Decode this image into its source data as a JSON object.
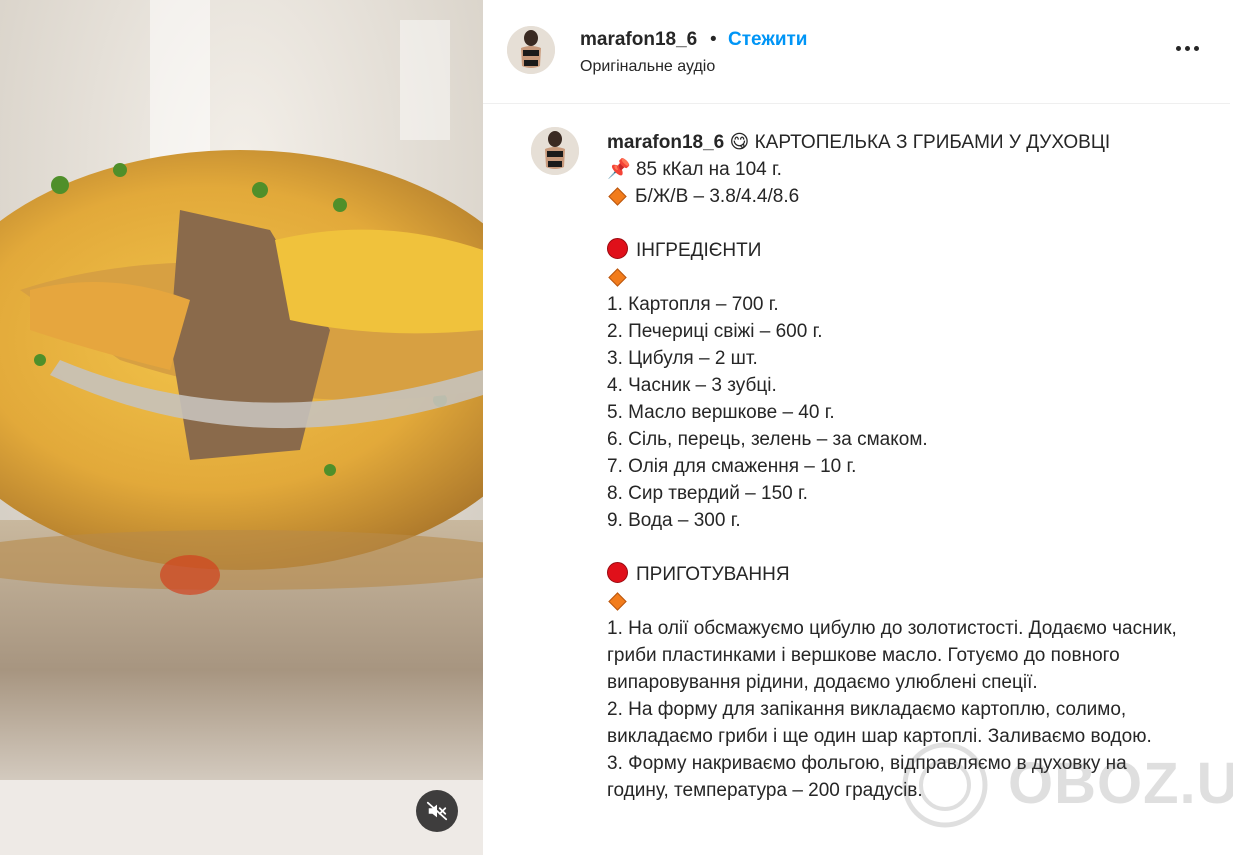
{
  "post": {
    "username": "marafon18_6",
    "separator": "•",
    "follow_label": "Стежити",
    "audio_label": "Оригінальне аудіо"
  },
  "caption": {
    "username": "marafon18_6",
    "title_emoji": "😋",
    "title": "КАРТОПЕЛЬКА З ГРИБАМИ У ДУХОВЦІ",
    "pin_emoji": "📌",
    "kcal": "85 кКал на 104 г.",
    "bju": "Б/Ж/В – 3.8/4.4/8.6",
    "ingredients_heading": "ІНГРЕДІЄНТИ",
    "ingredients": [
      "1. Картопля – 700 г.",
      "2. Печериці свіжі – 600 г.",
      "3. Цибуля – 2 шт.",
      "4. Часник – 3 зубці.",
      "5. Масло вершкове – 40 г.",
      "6. Сіль, перець, зелень – за смаком.",
      "7. Олія для смаження – 10 г.",
      "8. Сир твердий – 150 г.",
      "9. Вода – 300 г."
    ],
    "preparation_heading": "ПРИГОТУВАННЯ",
    "steps": [
      "1. На олії обсмажуємо цибулю до золотистості. Додаємо часник, гриби пластинками і вершкове масло. Готуємо до повного випаровування рідини, додаємо улюблені спеції.",
      "2. На форму для запікання викладаємо картоплю, солимо, викладаємо гриби і ще один шар картоплі. Заливаємо водою.",
      "3. Форму накриваємо фольгою, відправляємо в духовку на годину, температура – 200 градусів."
    ]
  },
  "watermark": {
    "text": "OBOZ.UA"
  },
  "icons": {
    "mute": "speaker-muted-icon",
    "more": "more-options-icon",
    "red_circle": "red-circle-icon",
    "orange_diamond": "orange-diamond-icon"
  },
  "colors": {
    "follow": "#0095f6",
    "text": "#262626",
    "red": "#e0101a",
    "orange": "#f27c1c"
  }
}
